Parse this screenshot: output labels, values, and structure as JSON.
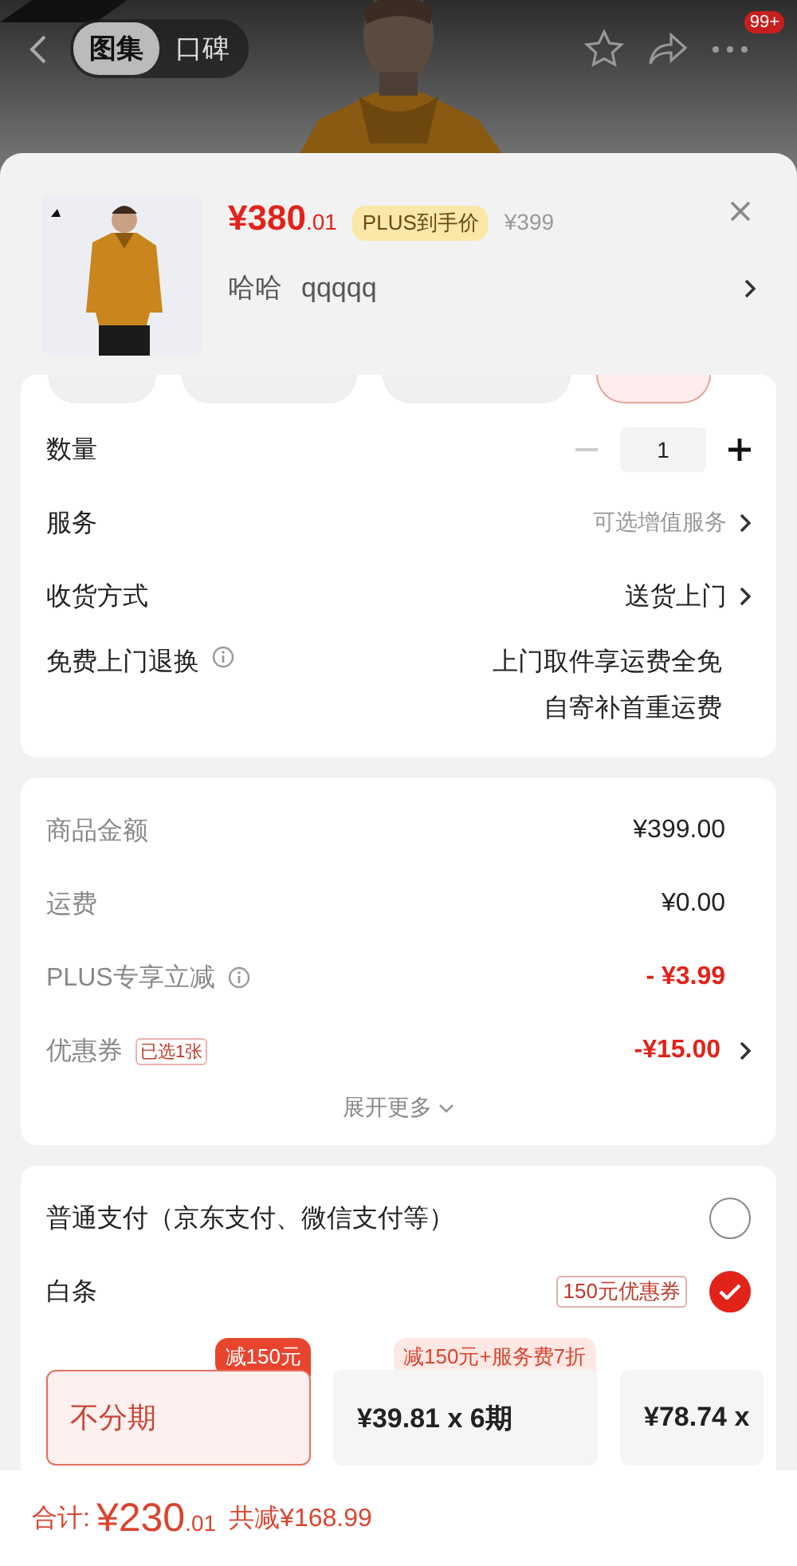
{
  "nav": {
    "tabs": [
      {
        "label": "图集",
        "selected": true
      },
      {
        "label": "口碑",
        "selected": false
      }
    ],
    "badge": "99+"
  },
  "product": {
    "price_main": "¥380",
    "price_cents": ".01",
    "price_tag": "PLUS到手价",
    "original_price": "¥399",
    "spec": "哈哈",
    "variant": "qqqqq"
  },
  "spec_chips": [
    {
      "selected": false
    },
    {
      "selected": false
    },
    {
      "selected": false
    },
    {
      "selected": true
    }
  ],
  "quantity": {
    "label": "数量",
    "value": "1"
  },
  "options": [
    {
      "label": "服务",
      "value": "可选增值服务",
      "kind": "hint"
    },
    {
      "label": "收货方式",
      "value": "送货上门",
      "kind": "value"
    }
  ],
  "return_service": {
    "label": "免费上门退换",
    "lines": [
      "上门取件享运费全免",
      "自寄补首重运费"
    ]
  },
  "amounts": [
    {
      "label": "商品金额",
      "value": "¥399.00",
      "kind": "plain"
    },
    {
      "label": "运费",
      "value": "¥0.00",
      "kind": "plain"
    },
    {
      "label": "PLUS专享立减",
      "value": "- ¥3.99",
      "kind": "info"
    },
    {
      "label": "优惠券",
      "value": "-¥15.00",
      "kind": "coupon",
      "badge": "已选1张"
    }
  ],
  "expand": "展开更多",
  "payment": {
    "methods": [
      {
        "label": "普通支付（京东支付、微信支付等）",
        "selected": false
      },
      {
        "label": "白条",
        "selected": true,
        "badge": "150元优惠券"
      }
    ],
    "plans": [
      {
        "title": "不分期",
        "tag": "减150元",
        "selected": true
      },
      {
        "title": "¥39.81 x 6期",
        "tag": "减150元+服务费7折",
        "selected": false
      },
      {
        "title": "¥78.74 x",
        "selected": false
      }
    ]
  },
  "total": {
    "label": "合计:",
    "main": "¥230",
    "cents": ".01",
    "saved": "共减¥168.99"
  }
}
